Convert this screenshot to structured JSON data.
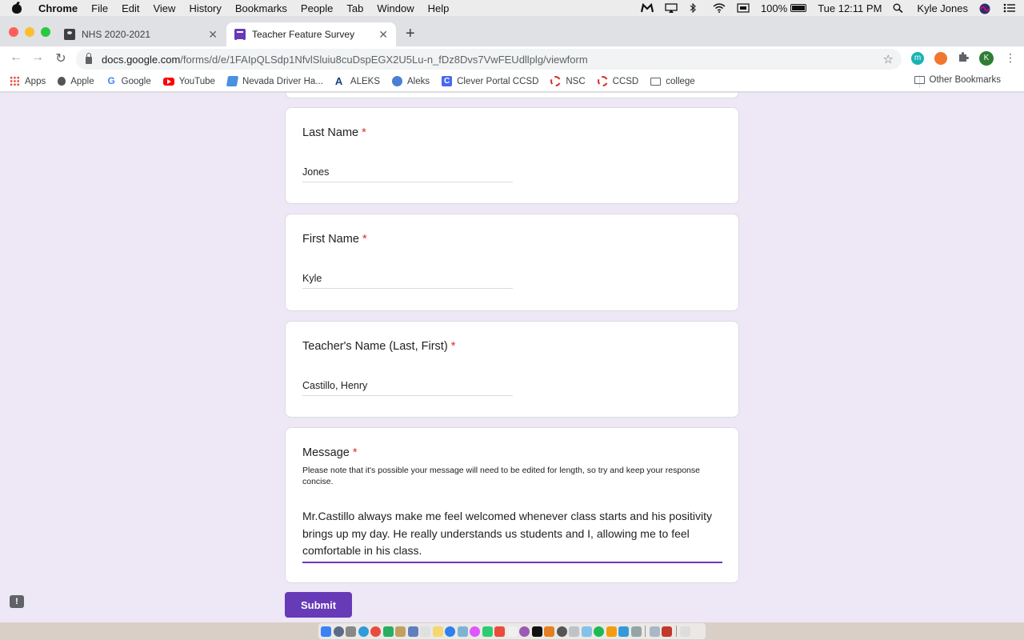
{
  "menubar": {
    "app": "Chrome",
    "items": [
      "File",
      "Edit",
      "View",
      "History",
      "Bookmarks",
      "People",
      "Tab",
      "Window",
      "Help"
    ],
    "battery": "100%",
    "clock": "Tue 12:11 PM",
    "user": "Kyle Jones"
  },
  "tabs": [
    {
      "title": "NHS 2020-2021",
      "icon": "classroom-icon",
      "active": false
    },
    {
      "title": "Teacher Feature Survey",
      "icon": "forms-icon",
      "active": true
    }
  ],
  "address": {
    "host": "docs.google.com",
    "path": "/forms/d/e/1FAIpQLSdp1NfvlSluiu8cuDspEGX2U5Lu-n_fDz8Dvs7VwFEUdllplg/viewform"
  },
  "profile_initial": "K",
  "bookmarks": [
    "Apps",
    "Apple",
    "Google",
    "YouTube",
    "Nevada Driver Ha...",
    "ALEKS",
    "Aleks",
    "Clever Portal CCSD",
    "NSC",
    "CCSD",
    "college"
  ],
  "other_bookmarks": "Other Bookmarks",
  "form": {
    "required_mark": "*",
    "last_name": {
      "label": "Last Name",
      "value": "Jones"
    },
    "first_name": {
      "label": "First Name",
      "value": "Kyle"
    },
    "teacher_name": {
      "label": "Teacher's Name (Last, First)",
      "value": "Castillo, Henry"
    },
    "message": {
      "label": "Message",
      "help": "Please note that it's possible your message will need to be edited for length, so try and keep your response concise.",
      "value": "Mr.Castillo always make me feel welcomed whenever class starts and his positivity brings up my day. He really understands us students and I, allowing me to feel comfortable in his class."
    },
    "submit_label": "Submit"
  },
  "colors": {
    "accent": "#673ab7",
    "page_bg": "#ede7f6",
    "required": "#d93025"
  }
}
